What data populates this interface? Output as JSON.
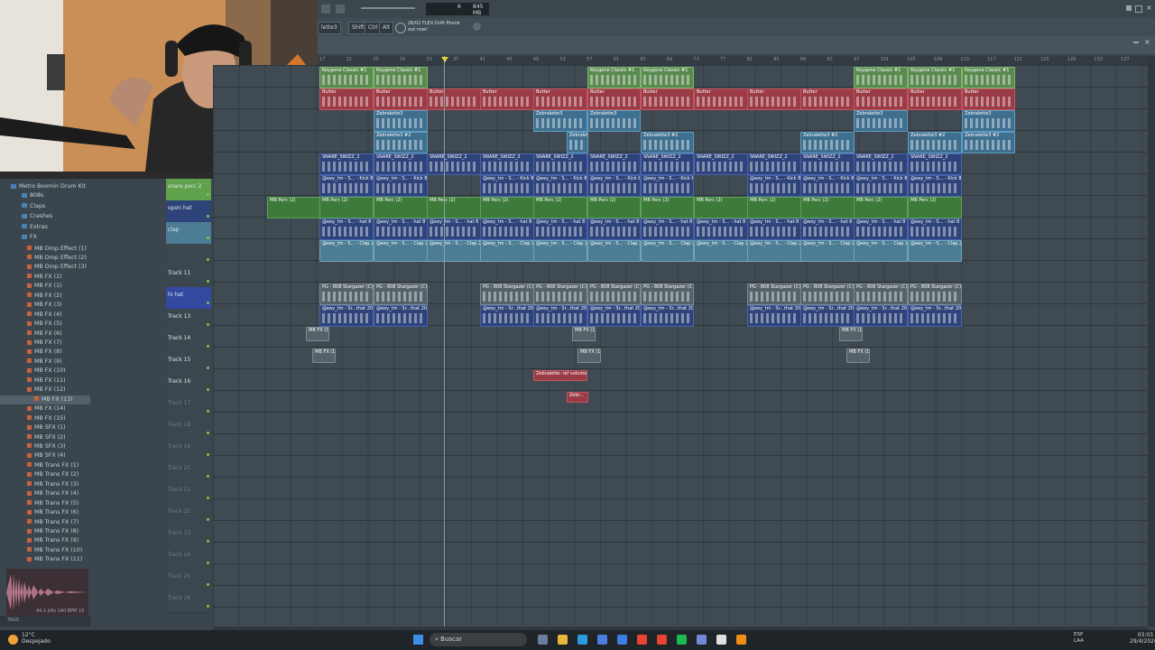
{
  "toolbar": {
    "memory": "845 MB",
    "memory_small": "6",
    "hint_line1": "26/02 FLEX Drift Phonk",
    "hint_line2": "out now!",
    "buttons": [
      "Shift",
      "Ctrl",
      "Alt"
    ],
    "pattern_selector": "lette3"
  },
  "ruler": {
    "marks": [
      "17",
      "21",
      "25",
      "29",
      "33",
      "37",
      "41",
      "45",
      "49",
      "53",
      "57",
      "61",
      "65",
      "69",
      "73",
      "77",
      "81",
      "85",
      "89",
      "93",
      "97",
      "101",
      "105",
      "109",
      "113",
      "117",
      "121",
      "125",
      "129",
      "133",
      "137"
    ]
  },
  "browser": {
    "root": "Metro Boomin Drum Kit",
    "folders": [
      "808s",
      "Claps",
      "Crashes",
      "Extras",
      "FX"
    ],
    "files": [
      "MB Drop Effect (1)",
      "MB Drop Effect (2)",
      "MB Drop Effect (3)",
      "MB FX (1)",
      "MB FX (1)",
      "MB FX (2)",
      "MB FX (3)",
      "MB FX (4)",
      "MB FX (5)",
      "MB FX (6)",
      "MB FX (7)",
      "MB FX (8)",
      "MB FX (9)",
      "MB FX (10)",
      "MB FX (11)",
      "MB FX (12)",
      "MB FX (13)",
      "MB FX (14)",
      "MB FX (15)",
      "MB SFX (1)",
      "MB SFX (2)",
      "MB SFX (3)",
      "MB SFX (4)",
      "MB Trans FX (1)",
      "MB Trans FX (2)",
      "MB Trans FX (3)",
      "MB Trans FX (4)",
      "MB Trans FX (5)",
      "MB Trans FX (6)",
      "MB Trans FX (7)",
      "MB Trans FX (8)",
      "MB Trans FX (9)",
      "MB Trans FX (10)",
      "MB Trans FX (11)"
    ],
    "selected_file": "MB FX (13)",
    "footer_info": "44.1 kHz 140 BPM 16",
    "footer_tags": "TAGS"
  },
  "tracks": {
    "snare_perc": "snare perc 2",
    "open_hat": "open hat",
    "clap": "clap",
    "track11": "Track 11",
    "hi_hat": "hi hat",
    "track13": "Track 13",
    "track14": "Track 14",
    "track15": "Track 15",
    "track16": "Track 16",
    "track17": "Track 17",
    "track18": "Track 18",
    "track19": "Track 19",
    "track20": "Track 20",
    "track21": "Track 21",
    "track22": "Track 22",
    "track23": "Track 23",
    "track24": "Track 24",
    "track25": "Track 25",
    "track26": "Track 26"
  },
  "clips": {
    "keygen": "Keygene Classic #1",
    "butter": "Butter",
    "zebra": "Zebralette3",
    "zebra2": "Zebralette3 #2",
    "snare_swizz": "SNARE_SWIZZ_2",
    "kick": "@eey_tm - S... - Kick 8",
    "mbperc": "MB Perc (2)",
    "openhat": "@eey_tm - S... - hat 8",
    "clap": "@eey_tm - S... - Clap 2",
    "stargazer": "PG - 808 Stargazer (C)",
    "hihat": "@eey_tm - Sr...that 20",
    "fx1": "MB FX (1)",
    "fx2": "MB FX (1)",
    "zebra_auto": "Zebralette: ref volume",
    "zebra_auto2": "Zebr..."
  },
  "taskbar": {
    "search": "Buscar",
    "weather_temp": "12°C",
    "weather_desc": "Despejado",
    "time": "03:03",
    "date": "29/4/2026",
    "lang1": "ESP",
    "lang2": "LAA"
  },
  "colors": {
    "accent_green": "#5a8a4f",
    "accent_red": "#9a3b45",
    "accent_navy": "#2e4379",
    "led_green": "#6fcf4c"
  }
}
